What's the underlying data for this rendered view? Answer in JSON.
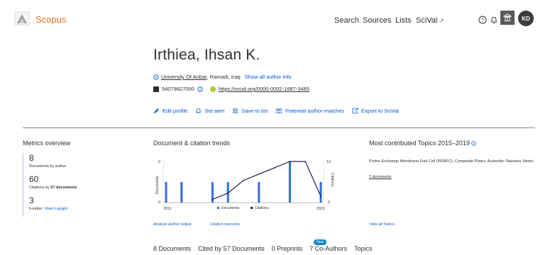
{
  "header": {
    "brand": "Scopus",
    "nav": [
      "Search",
      "Sources",
      "Lists",
      "SciVal"
    ],
    "scival_ext": "↗",
    "avatar_initials": "KD"
  },
  "author": {
    "name": "Irthiea, Ihsan K.",
    "affiliation": "University Of Anbar",
    "location": ", Ramadi, Iraq",
    "show_all": "Show all author info",
    "author_id": "54079827000",
    "orcid_url": "https://orcid.org/0000-0002-1687-3485"
  },
  "actions": [
    "Edit profile",
    "Set alert",
    "Save to list",
    "Potential author matches",
    "Export to SciVal"
  ],
  "metrics": {
    "title": "Metrics overview",
    "documents": "8",
    "documents_label": "Documents by author",
    "citations": "60",
    "citations_label_pre": "Citations by",
    "citations_label_bold": "57 documents",
    "hindex": "3",
    "hindex_label": "h-index:",
    "hindex_link": "View h-graph"
  },
  "trends": {
    "title": "Document & citation trends",
    "left_axis": "Documents",
    "right_axis": "Citations",
    "y_left_ticks": [
      "2",
      "0"
    ],
    "y_right_ticks": [
      "13",
      "0"
    ],
    "x_start": "2011",
    "x_end": "2021",
    "legend_docs": "Documents",
    "legend_cits": "Citations",
    "link1": "Analyze author output",
    "link2": "Citation overview"
  },
  "topics": {
    "title": "Most contributed Topics 2015–2019",
    "topic": "Proton Exchange Membrane Fuel Cell (PEMFC); Composite Plates; Austenitic Stainless Steels",
    "docs": "2 documents",
    "view_all": "View all Topics"
  },
  "tabs": [
    "8 Documents",
    "Cited by 57 Documents",
    "0 Preprints",
    "7 Co-Authors",
    "Topics"
  ],
  "new_badge": "New",
  "colors": {
    "brand": "#e9711c",
    "link": "#0056d6",
    "bar": "#2e6fd9",
    "line": "#1f1f5c"
  },
  "chart_data": {
    "type": "bar",
    "title": "Document & citation trends",
    "x": [
      2011,
      2012,
      2013,
      2014,
      2015,
      2016,
      2017,
      2018,
      2019,
      2020,
      2021
    ],
    "ylabel": "Documents",
    "y2label": "Citations",
    "ylim": [
      0,
      2
    ],
    "y2lim": [
      0,
      13
    ],
    "series": [
      {
        "name": "Documents",
        "type": "bar",
        "values": [
          1,
          1,
          0,
          1,
          1,
          0,
          1,
          0,
          2,
          0,
          1
        ]
      },
      {
        "name": "Citations",
        "type": "line",
        "values": [
          null,
          null,
          null,
          1,
          3,
          7,
          9,
          11,
          13,
          13,
          2
        ]
      }
    ]
  }
}
